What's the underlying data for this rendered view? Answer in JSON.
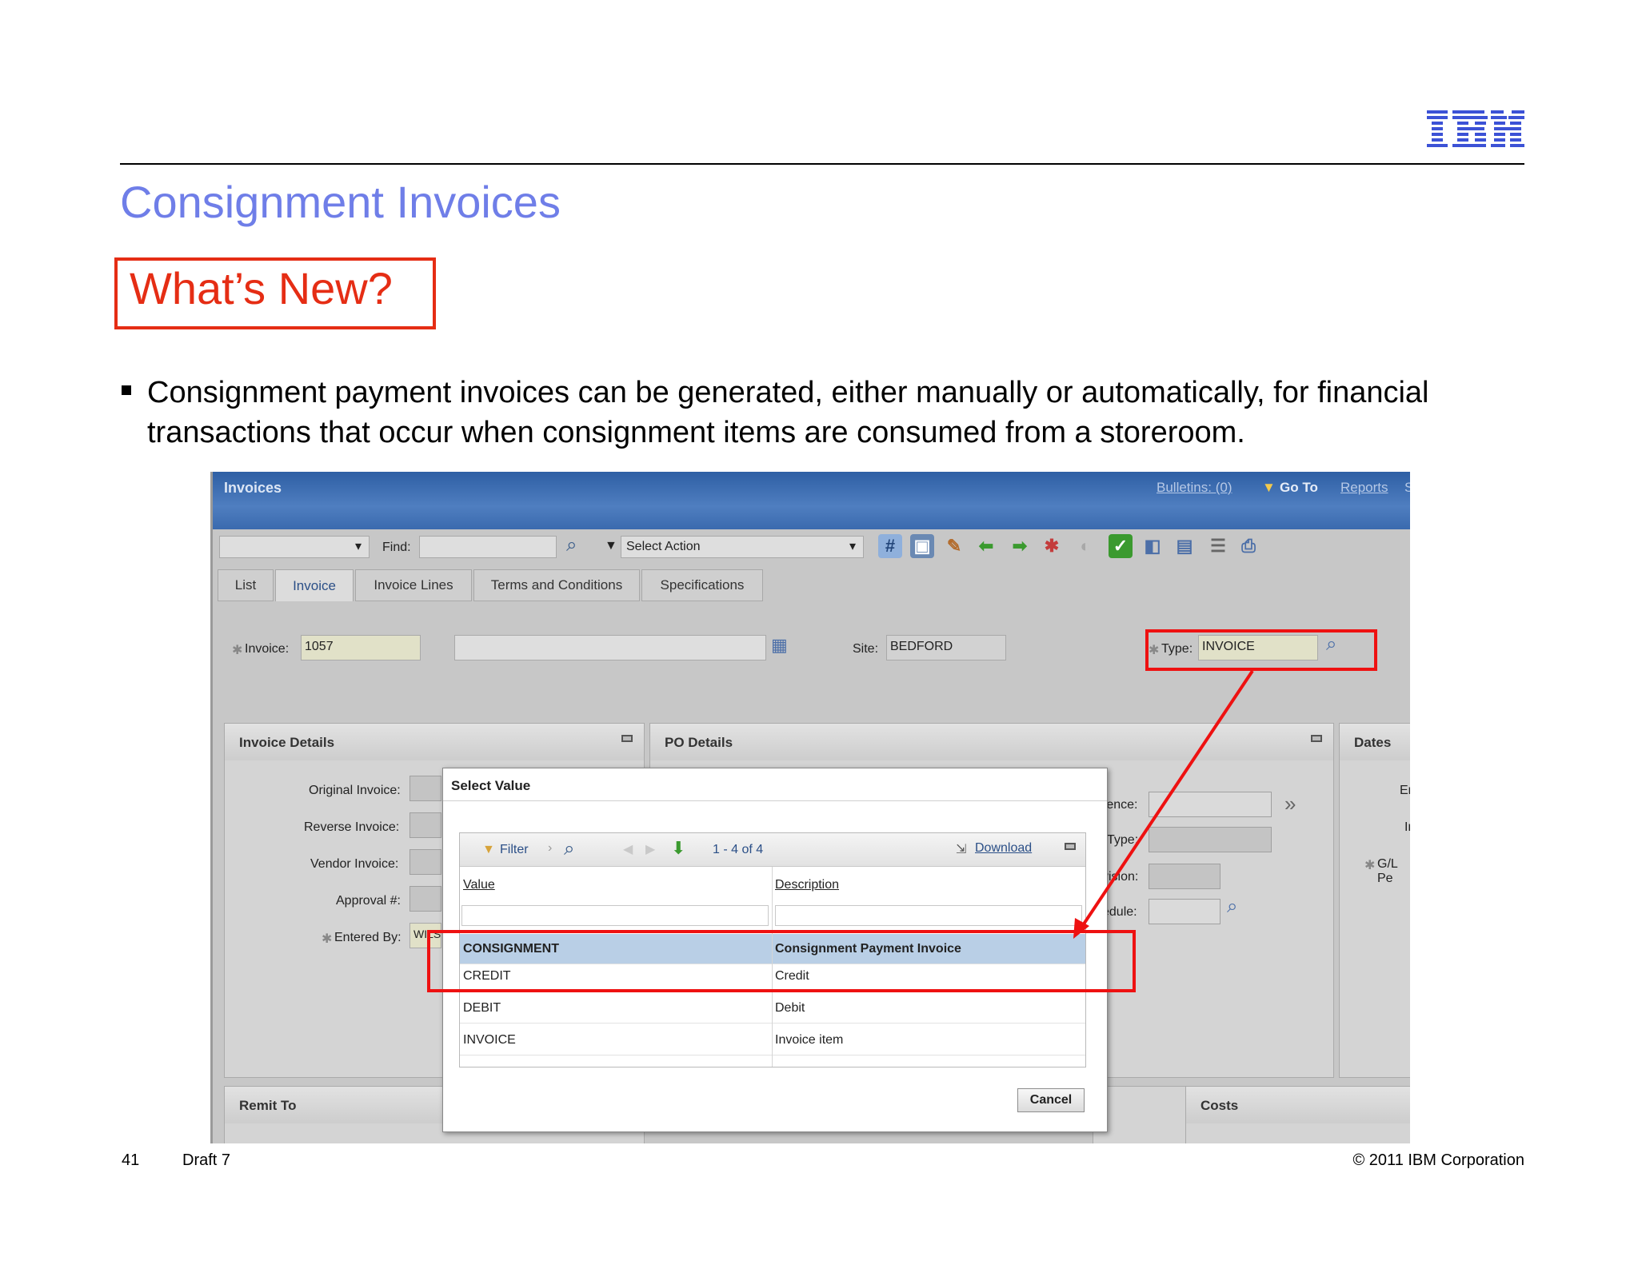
{
  "slide": {
    "title": "Consignment Invoices",
    "whats_new": "What’s New?",
    "bullet": "Consignment payment invoices can be generated, either manually or automatically, for financial transactions that occur when consignment items are consumed from a storeroom.",
    "page_number": "41",
    "draft": "Draft 7",
    "copyright": "© 2011 IBM Corporation",
    "logo": "IBM"
  },
  "app": {
    "title": "Invoices",
    "nav": {
      "bulletins": "Bulletins: (0)",
      "goto": "Go To",
      "reports": "Reports",
      "more": "S"
    }
  },
  "toolbar": {
    "find_label": "Find:",
    "select_action": "Select Action",
    "icons": [
      "new-record-icon",
      "save-icon",
      "clear-changes-icon",
      "previous-record-icon",
      "next-record-icon",
      "workflow-icon",
      "status-icon",
      "approve-icon",
      "route-icon",
      "reports-icon",
      "list-icon",
      "print-icon"
    ]
  },
  "tabs": [
    "List",
    "Invoice",
    "Invoice Lines",
    "Terms and Conditions",
    "Specifications"
  ],
  "active_tab": "Invoice",
  "header_fields": {
    "invoice_label": "Invoice:",
    "invoice_value": "1057",
    "site_label": "Site:",
    "site_value": "BEDFORD",
    "type_label": "Type:",
    "type_value": "INVOICE"
  },
  "sections": {
    "invoice_details": {
      "title": "Invoice Details",
      "labels": [
        "Original Invoice:",
        "Reverse Invoice:",
        "Vendor Invoice:",
        "Approval #:",
        "Entered By:"
      ],
      "entered_by_value": "WILS"
    },
    "po_details": {
      "title": "PO Details",
      "labels": [
        "rence:",
        "Type:",
        "vision:",
        "edule:"
      ]
    },
    "dates": {
      "title": "Dates",
      "labels": [
        "Er",
        "In",
        "G/L Pe"
      ]
    },
    "remit_to": {
      "title": "Remit To"
    },
    "costs": {
      "title": "Costs"
    }
  },
  "modal": {
    "title": "Select Value",
    "filter": "Filter",
    "pager": "1 - 4 of 4",
    "download": "Download",
    "columns": [
      "Value",
      "Description"
    ],
    "rows": [
      {
        "value": "CONSIGNMENT",
        "description": "Consignment Payment Invoice",
        "selected": true
      },
      {
        "value": "CREDIT",
        "description": "Credit"
      },
      {
        "value": "DEBIT",
        "description": "Debit"
      },
      {
        "value": "INVOICE",
        "description": "Invoice item"
      }
    ],
    "cancel": "Cancel"
  },
  "colors": {
    "title_blue": "#6f7ee8",
    "callout_red": "#e52d14",
    "highlight_red": "#ee1111",
    "selected_row": "#b9cfe6"
  }
}
